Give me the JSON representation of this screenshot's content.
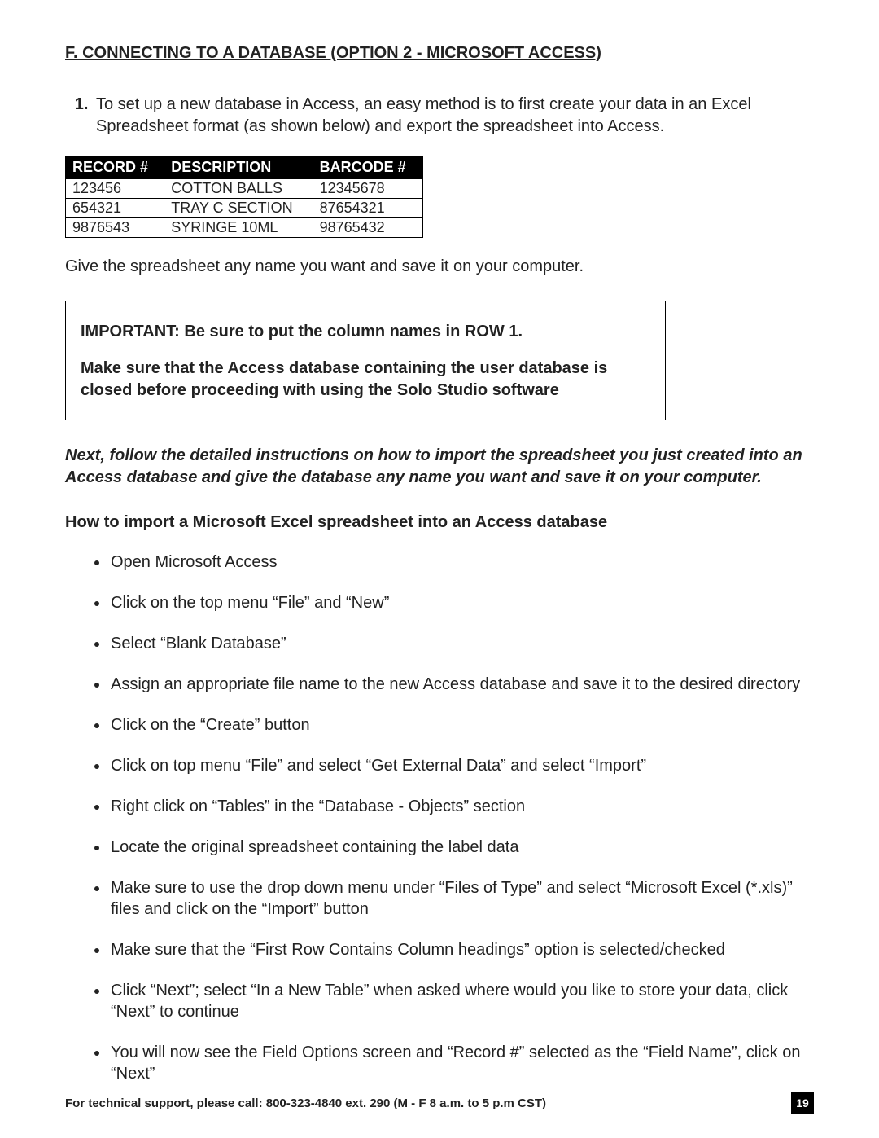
{
  "heading": "F. CONNECTING TO A DATABASE (OPTION 2 - MICROSOFT ACCESS)",
  "step1": "To set up a new database in Access, an easy method is to first create your data in an Excel Spreadsheet format (as shown below) and export the spreadsheet into Access.",
  "table": {
    "headers": [
      "RECORD #",
      "DESCRIPTION",
      "BARCODE #"
    ],
    "rows": [
      [
        "123456",
        "COTTON BALLS",
        "12345678"
      ],
      [
        "654321",
        "TRAY C SECTION",
        "87654321"
      ],
      [
        "9876543",
        "SYRINGE 10ML",
        "98765432"
      ]
    ]
  },
  "after_table": "Give the spreadsheet any name you want and save it on your computer.",
  "important_box": {
    "line1": "IMPORTANT: Be sure to put the column names in ROW 1.",
    "line2": "Make sure that the Access database containing the user database is closed before proceeding with using the Solo Studio software"
  },
  "italic_note": "Next, follow the detailed instructions on how to import the spreadsheet you just created into an Access database and give the database any name you want and save it on your computer.",
  "subheading": "How to import a Microsoft Excel spreadsheet into an Access database",
  "bullets": [
    "Open Microsoft Access",
    "Click on the top menu “File” and “New”",
    "Select “Blank Database”",
    "Assign an appropriate file name to the new Access database and save it to the desired directory",
    "Click on the “Create” button",
    "Click on top menu “File” and select “Get External Data” and select “Import”",
    "Right click on “Tables” in the “Database - Objects” section",
    "Locate the original spreadsheet containing the label data",
    "Make sure to use the drop down menu under “Files of Type” and select “Microsoft Excel (*.xls)” files and click on the “Import” button",
    "Make sure that the “First Row Contains Column headings” option is selected/checked",
    "Click “Next”; select “In a New Table” when asked where would you like to store your data, click “Next” to continue",
    "You will now see the Field Options screen and “Record #” selected as the “Field Name”, click on “Next”"
  ],
  "footer": {
    "support": "For technical support, please call: 800-323-4840 ext. 290 (M - F  8 a.m. to 5 p.m CST)",
    "page": "19"
  }
}
